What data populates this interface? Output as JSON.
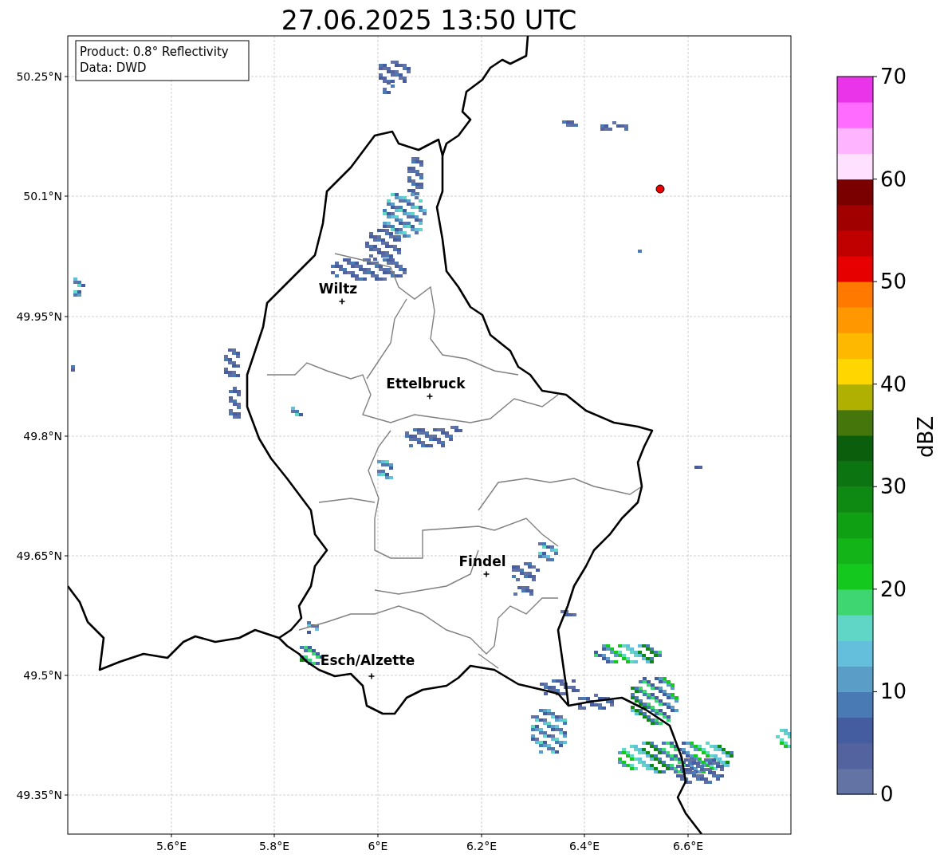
{
  "title": "27.06.2025 13:50 UTC",
  "info_box": {
    "lines": [
      "Product: 0.8° Reflectivity",
      "Data: DWD"
    ]
  },
  "map": {
    "cities": [
      {
        "name": "Wiltz"
      },
      {
        "name": "Ettelbruck"
      },
      {
        "name": "Findel"
      },
      {
        "name": "Esch/Alzette"
      }
    ],
    "y_ticks": [
      "50.25°N",
      "50.1°N",
      "49.95°N",
      "49.8°N",
      "49.65°N",
      "49.5°N",
      "49.35°N"
    ],
    "x_ticks": [
      "5.6°E",
      "5.8°E",
      "6°E",
      "6.2°E",
      "6.4°E",
      "6.6°E"
    ]
  },
  "colorbar": {
    "label": "dBZ",
    "ticks": [
      "70",
      "60",
      "50",
      "40",
      "30",
      "20",
      "10",
      "0"
    ],
    "segments": [
      {
        "color": "#6373a3"
      },
      {
        "color": "#53639f"
      },
      {
        "color": "#435da0"
      },
      {
        "color": "#4a7ab3"
      },
      {
        "color": "#5a9ec8"
      },
      {
        "color": "#64bfdc"
      },
      {
        "color": "#5fd6c6"
      },
      {
        "color": "#3dd670"
      },
      {
        "color": "#14c81e"
      },
      {
        "color": "#12b418"
      },
      {
        "color": "#10a014"
      },
      {
        "color": "#0e8a12"
      },
      {
        "color": "#0c7410"
      },
      {
        "color": "#0a5e0c"
      },
      {
        "color": "#44760c"
      },
      {
        "color": "#b0b000"
      },
      {
        "color": "#ffd600"
      },
      {
        "color": "#ffb800"
      },
      {
        "color": "#ff9800"
      },
      {
        "color": "#ff7800"
      },
      {
        "color": "#e60000"
      },
      {
        "color": "#c00000"
      },
      {
        "color": "#a00000"
      },
      {
        "color": "#7a0000"
      },
      {
        "color": "#ffe0ff"
      },
      {
        "color": "#ffb4ff"
      },
      {
        "color": "#ff6cff"
      },
      {
        "color": "#ea34ea"
      }
    ]
  }
}
